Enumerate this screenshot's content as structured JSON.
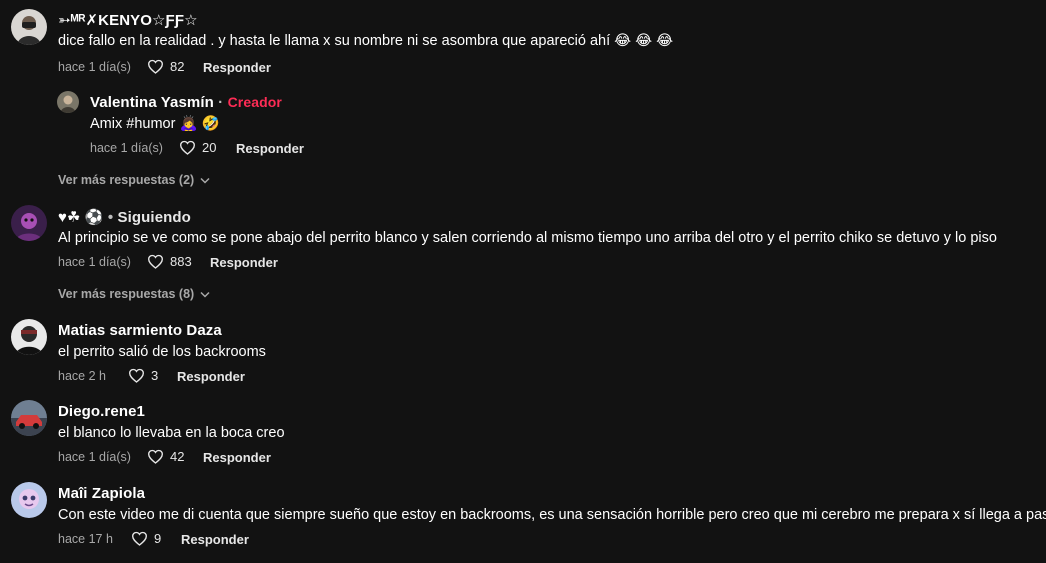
{
  "icons": {
    "like": "heart-outline-icon",
    "expand": "chevron-down-icon"
  },
  "colors": {
    "background": "#121212",
    "creator_badge": "#fe2c55",
    "muted": "#a8a8a8"
  },
  "comments": [
    {
      "username": "➳ᴹᴿ✗KENYO☆ƑƑ☆",
      "text": "dice fallo en la realidad . y hasta le llama x su nombre ni se asombra que apareció ahí 😂 😂 😂",
      "time": "hace 1 día(s)",
      "likes": "82",
      "reply_label": "Responder"
    },
    {
      "username": "Valentina Yasmín",
      "separator": "·",
      "badge": "Creador",
      "text": "Amix #humor 🙇‍♀️ 🤣",
      "time": "hace 1 día(s)",
      "likes": "20",
      "reply_label": "Responder"
    },
    {
      "more_replies": "Ver más respuestas (2)"
    },
    {
      "username": "♥☘ ⚽",
      "separator": "•",
      "status": "Siguiendo",
      "text": "Al principio se ve como se pone abajo del perrito blanco y salen corriendo al mismo tiempo uno arriba del otro y el perrito chiko se detuvo y lo piso",
      "time": "hace 1 día(s)",
      "likes": "883",
      "reply_label": "Responder"
    },
    {
      "more_replies": "Ver más respuestas (8)"
    },
    {
      "username": "Matias sarmiento Daza",
      "text": "el perrito salió de los backrooms",
      "time": "hace 2 h",
      "likes": "3",
      "reply_label": "Responder"
    },
    {
      "username": "Diego.rene1",
      "text": "el blanco lo llevaba en la boca creo",
      "time": "hace 1 día(s)",
      "likes": "42",
      "reply_label": "Responder"
    },
    {
      "username": "Maîi Zapiola",
      "text": "Con este video me di cuenta que siempre sueño que estoy en backrooms, es una sensación horrible pero creo que mi cerebro me prepara x sí llega a pasar",
      "time": "hace 17 h",
      "likes": "9",
      "reply_label": "Responder"
    }
  ]
}
